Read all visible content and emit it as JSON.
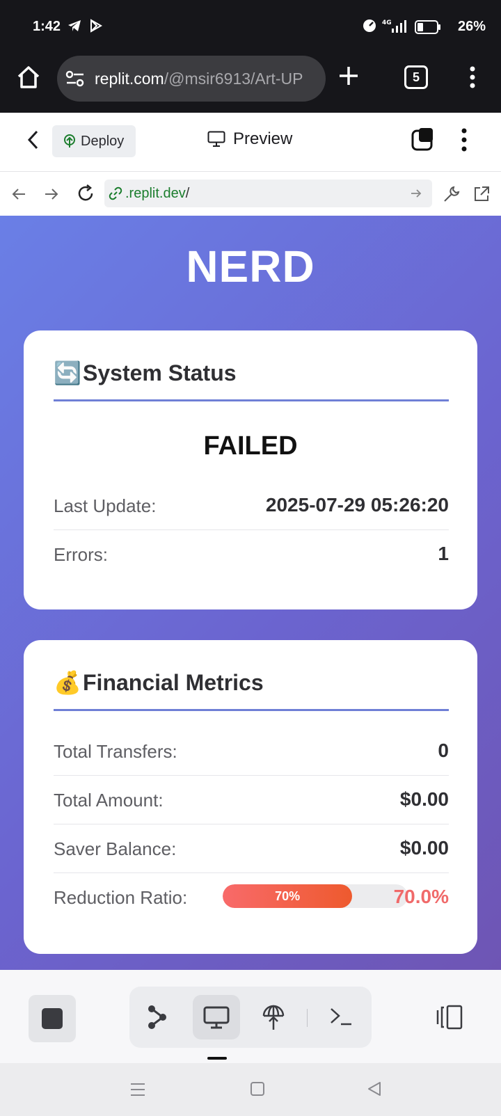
{
  "status_bar": {
    "time": "1:42",
    "network": "4G",
    "battery": "26%"
  },
  "browser": {
    "url_host": "replit.com",
    "url_path": "/@msir6913/Art-UP",
    "tab_count": "5"
  },
  "replit_header": {
    "deploy_label": "Deploy",
    "preview_label": "Preview"
  },
  "address_bar": {
    "domain": ".replit.dev",
    "path": "/"
  },
  "app": {
    "title": "NERD",
    "system_status": {
      "heading": "System Status",
      "emoji": "🔄",
      "status": "FAILED",
      "rows": [
        {
          "label": "Last Update:",
          "value": "2025-07-29 05:26:20"
        },
        {
          "label": "Errors:",
          "value": "1"
        }
      ]
    },
    "financial_metrics": {
      "heading": "Financial Metrics",
      "emoji": "💰",
      "rows": [
        {
          "label": "Total Transfers:",
          "value": "0"
        },
        {
          "label": "Total Amount:",
          "value": "$0.00"
        },
        {
          "label": "Saver Balance:",
          "value": "$0.00"
        }
      ],
      "reduction": {
        "label": "Reduction Ratio:",
        "bar_text": "70%",
        "value": "70.0%",
        "fraction": 0.7
      }
    }
  },
  "colors": {
    "accent": "#6f7fd6",
    "progress_start": "#f86a6a",
    "progress_end": "#ee5a2e",
    "ratio_text": "#f06a6a"
  }
}
